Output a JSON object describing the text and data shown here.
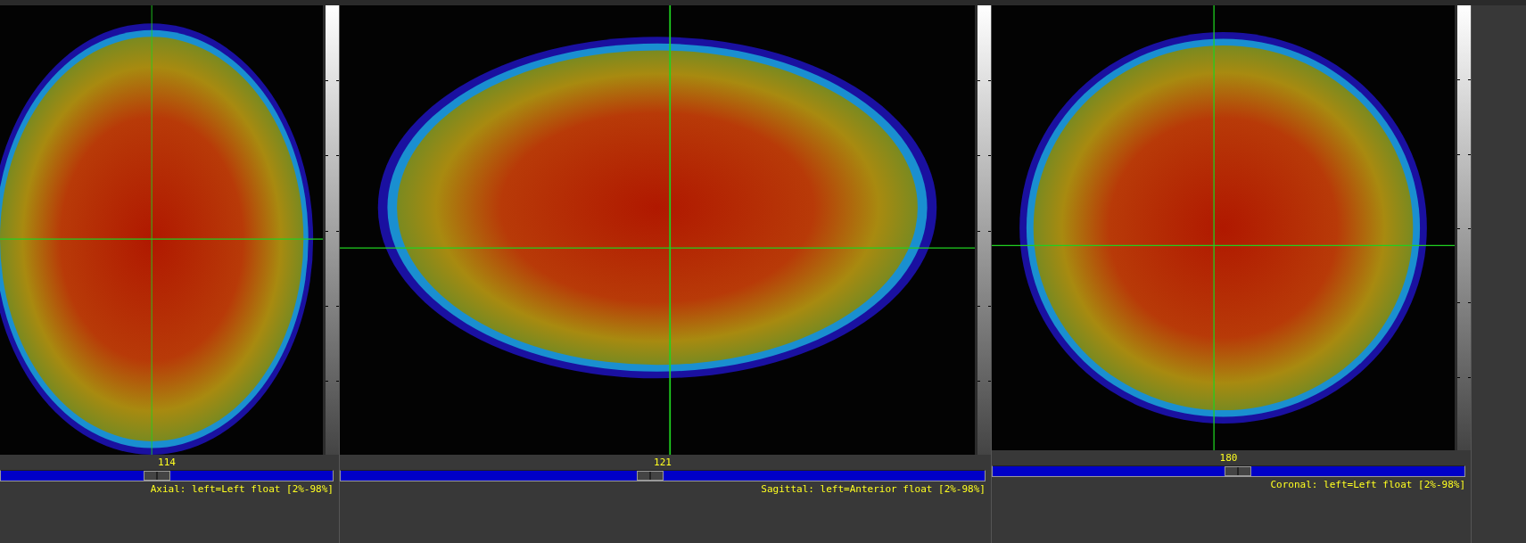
{
  "views": [
    {
      "kind": "axial",
      "slice": "114",
      "level": 0.47,
      "label": "Axial: left=Left float [2%-98%]"
    },
    {
      "kind": "sagittal",
      "slice": "121",
      "level": 0.48,
      "label": "Sagittal: left=Anterior float [2%-98%]"
    },
    {
      "kind": "coronal",
      "slice": "180",
      "level": 0.52,
      "label": "Coronal: left=Left float [2%-98%]"
    }
  ]
}
